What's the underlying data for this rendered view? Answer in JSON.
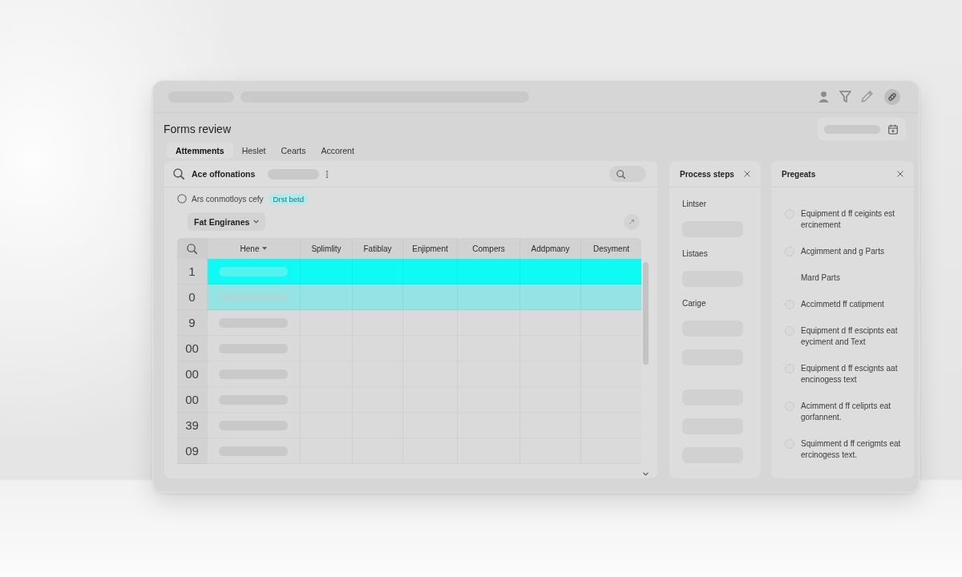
{
  "top_bar": {
    "loading": true
  },
  "header": {
    "title": "Forms review",
    "date_field": {
      "loading": true
    }
  },
  "tabs": [
    {
      "label": "Attemments",
      "selected": true
    },
    {
      "label": "Heslet",
      "selected": false
    },
    {
      "label": "Cearts",
      "selected": false
    },
    {
      "label": "Accorent",
      "selected": false
    }
  ],
  "main": {
    "search": {
      "label": "Ace offonations",
      "loading": true
    },
    "status": {
      "text": "Ars conmotloys cefy",
      "badge": "Drst betd"
    },
    "filter": {
      "label": "Fat Engiranes"
    },
    "table": {
      "columns": [
        {
          "label": "Hene",
          "sorted": true
        },
        {
          "label": "Splimlity",
          "sorted": false
        },
        {
          "label": "Fatiblay",
          "sorted": false
        },
        {
          "label": "Enjipment",
          "sorted": false
        },
        {
          "label": "Compers",
          "sorted": false
        },
        {
          "label": "Addpmany",
          "sorted": false
        },
        {
          "label": "Desyment",
          "sorted": false
        }
      ],
      "rows": [
        {
          "number": "1",
          "selected": true,
          "highlighted": false,
          "loading": true
        },
        {
          "number": "0",
          "selected": false,
          "highlighted": true,
          "loading": true
        },
        {
          "number": "9",
          "selected": false,
          "highlighted": false,
          "loading": true
        },
        {
          "number": "00",
          "selected": false,
          "highlighted": false,
          "loading": true
        },
        {
          "number": "00",
          "selected": false,
          "highlighted": false,
          "loading": true
        },
        {
          "number": "00",
          "selected": false,
          "highlighted": false,
          "loading": true
        },
        {
          "number": "39",
          "selected": false,
          "highlighted": false,
          "loading": true
        },
        {
          "number": "09",
          "selected": false,
          "highlighted": false,
          "loading": true
        }
      ]
    }
  },
  "process_steps": {
    "title": "Process steps",
    "sections": [
      {
        "label": "Lintser",
        "fields": [
          {
            "kind": "input"
          }
        ]
      },
      {
        "label": "Listaes",
        "fields": [
          {
            "kind": "input"
          }
        ]
      },
      {
        "label": "Carige",
        "fields": [
          {
            "kind": "input"
          },
          {
            "kind": "input"
          }
        ]
      },
      {
        "fields": [
          {
            "kind": "input"
          },
          {
            "kind": "input"
          },
          {
            "kind": "input"
          }
        ]
      }
    ]
  },
  "right_panel": {
    "title": "Pregeats",
    "items": [
      {
        "kind": "option",
        "checked": false,
        "text": "Equipment d ff ceigints est ercinement"
      },
      {
        "kind": "option",
        "checked": false,
        "text": "Acgimment and g Parts"
      },
      {
        "kind": "label",
        "text": "Mard Parts"
      },
      {
        "kind": "option",
        "checked": false,
        "text": "Accimmetd ff catipment"
      },
      {
        "kind": "option",
        "checked": false,
        "text": "Equipment d ff escipnts eat eyciment and Text"
      },
      {
        "kind": "option",
        "checked": false,
        "text": "Equipment d ff escignts aat encinogess text"
      },
      {
        "kind": "option",
        "checked": false,
        "text": "Acimment d ff celiprts eat gorfannent."
      },
      {
        "kind": "option",
        "checked": false,
        "text": "Squimment d ff cerigmts eat ercinogess text."
      }
    ]
  }
}
